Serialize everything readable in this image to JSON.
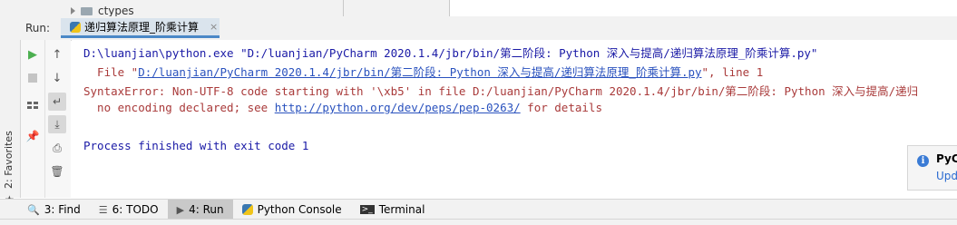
{
  "project_tree": {
    "visible_item": "ctypes"
  },
  "favorites": {
    "label": "2: Favorites"
  },
  "run_panel": {
    "label": "Run:",
    "tab": {
      "title": "递归算法原理_阶乘计算",
      "close": "×"
    }
  },
  "toolbar": {
    "rerun_icon": "play-icon",
    "stop_icon": "stop-icon"
  },
  "console": {
    "line1": "D:\\luanjian\\python.exe \"D:/luanjian/PyCharm 2020.1.4/jbr/bin/第二阶段: Python 深入与提高/递归算法原理_阶乘计算.py\"",
    "line2_prefix": "  File \"",
    "line2_link": "D:/luanjian/PyCharm 2020.1.4/jbr/bin/第二阶段: Python 深入与提高/递归算法原理_阶乘计算.py",
    "line2_suffix": "\", line 1",
    "line3": "SyntaxError: Non-UTF-8 code starting with '\\xb5' in file D:/luanjian/PyCharm 2020.1.4/jbr/bin/第二阶段: Python 深入与提高/递归",
    "line4_prefix": "  no encoding declared; see ",
    "line4_link": "http://python.org/dev/peps/pep-0263/",
    "line4_suffix": " for details",
    "line5": "Process finished with exit code 1"
  },
  "notification": {
    "icon": "i",
    "title": "PyC",
    "link": "Upd"
  },
  "bottom_bar": {
    "items": [
      {
        "label": "3: Find",
        "icon": "search-icon"
      },
      {
        "label": "6: TODO",
        "icon": "list-icon"
      },
      {
        "label": "4: Run",
        "icon": "play-icon"
      },
      {
        "label": "Python Console",
        "icon": "python-icon"
      },
      {
        "label": "Terminal",
        "icon": "terminal-icon"
      }
    ]
  }
}
